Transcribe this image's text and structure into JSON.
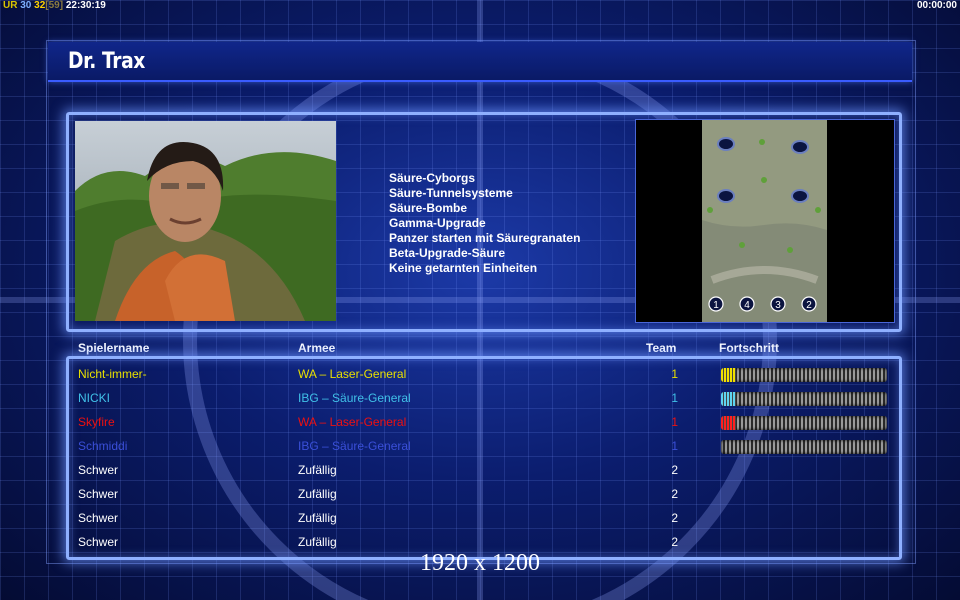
{
  "hud": {
    "left_ur": "UR",
    "left_a": "30",
    "left_b": "32",
    "left_c": "[59]",
    "left_time": "22:30:19",
    "right_time": "00:00:00"
  },
  "title": "Dr. Trax",
  "bullets": [
    "Säure-Cyborgs",
    "Säure-Tunnelsysteme",
    "Säure-Bombe",
    "Gamma-Upgrade",
    "Panzer starten mit Säuregranaten",
    "Beta-Upgrade-Säure",
    "Keine getarnten Einheiten"
  ],
  "minimap_slots": [
    "1",
    "4",
    "3",
    "2"
  ],
  "columns": {
    "name": "Spielername",
    "army": "Armee",
    "team": "Team",
    "progress": "Fortschritt"
  },
  "players": [
    {
      "name": "Nicht-immer-",
      "army": "WA – Laser-General",
      "team": "1",
      "color": "#e8e000",
      "progress": 0.09,
      "bar_color": "#f0e000"
    },
    {
      "name": "NICKI",
      "army": "IBG – Säure-General",
      "team": "1",
      "color": "#40c0e8",
      "progress": 0.09,
      "bar_color": "#5fd4f0"
    },
    {
      "name": "Skyfire",
      "army": "WA – Laser-General",
      "team": "1",
      "color": "#ee1010",
      "progress": 0.09,
      "bar_color": "#ff2020"
    },
    {
      "name": "Schmiddi",
      "army": "IBG – Säure-General",
      "team": "1",
      "color": "#3a4fd8",
      "progress": 0.0,
      "bar_color": "#3a4fd8"
    },
    {
      "name": "Schwer",
      "army": "Zufällig",
      "team": "2",
      "color": "#ffffff"
    },
    {
      "name": "Schwer",
      "army": "Zufällig",
      "team": "2",
      "color": "#ffffff"
    },
    {
      "name": "Schwer",
      "army": "Zufällig",
      "team": "2",
      "color": "#ffffff"
    },
    {
      "name": "Schwer",
      "army": "Zufällig",
      "team": "2",
      "color": "#ffffff"
    }
  ],
  "footer": "1920 x 1200"
}
